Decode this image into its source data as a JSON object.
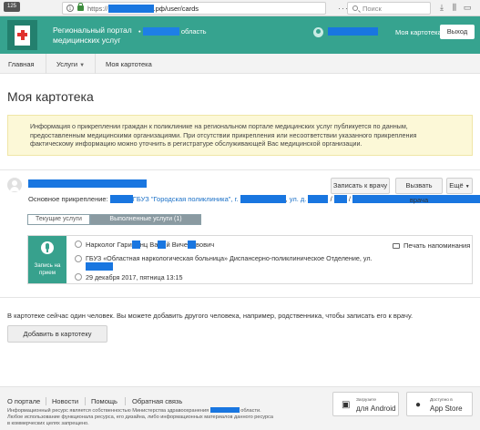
{
  "browser": {
    "tab_badge": "125",
    "url_prefix": "https://",
    "url_suffix": ".рф/user/cards",
    "search_placeholder": "Поиск"
  },
  "header": {
    "portal_title": "Региональный портал медицинских услуг",
    "region_suffix": "область",
    "my_card_link": "Моя картотека",
    "logout_label": "Выход"
  },
  "breadcrumb": {
    "items": [
      "Главная",
      "Услуги",
      "Моя картотека"
    ]
  },
  "page": {
    "title": "Моя картотека",
    "notice": "Информация о прикреплении граждан к поликлинике на региональном портале медицинских услуг публикуется по данным, предоставленным медицинскими организациями. При отсутствии прикрепления или несоответствии указанного прикрепления фактическому информацию можно уточнить в регистратуре обслуживающей Вас медицинской организации."
  },
  "person": {
    "attach_label": "Основное прикрепление:",
    "attach_org": "ГБУЗ \"Городская поликлиника\", г.",
    "attach_street": "ул. д.",
    "buttons": {
      "book_doctor": "Записать к врачу",
      "call_doctor": "Вызвать врача",
      "more": "Ещё"
    },
    "tabs": {
      "current": "Текущие услуги",
      "done": "Выполненные услуги (1)"
    }
  },
  "appointment": {
    "type_label": "Запись на прием",
    "doctor_spec": "Нарколог",
    "doctor_name_1": "Гари",
    "doctor_name_2": "нц Ва",
    "doctor_name_3": "й Виче",
    "doctor_name_4": "вович",
    "place": "ГБУЗ «Областная наркологическая больница» Диспансерно-поликлиническое Отделение, ул.",
    "date": "29 декабря 2017, пятница 13:15",
    "print_label": "Печать напоминания"
  },
  "footer_section": {
    "info": "В картотеке сейчас один человек. Вы можете добавить другого человека, например, родственника, чтобы записать его к врачу.",
    "add_button": "Добавить в картотеку"
  },
  "footer": {
    "links": [
      "О портале",
      "Новости",
      "Помощь",
      "Обратная связь"
    ],
    "text_1": "Информационный ресурс является собственностью Министерства здравоохранения",
    "text_2": "области.",
    "text_3": "Любое использование функционала ресурса, его дизайна, либо информационных материалов данного ресурса",
    "text_4": "в коммерческих целях запрещено.",
    "android": {
      "small": "Загрузите",
      "big": "для Android"
    },
    "apple": {
      "small": "Доступно в",
      "big": "App Store"
    }
  },
  "colors": {
    "header_green": "#36a38f",
    "logo_dark": "#23806e",
    "redaction_blue": "#1976e0",
    "notice_bg": "#fcf8d7",
    "link_blue": "#1a70c7",
    "tab_active": "#8a9aa1"
  },
  "icons": [
    "info-icon",
    "lock-icon",
    "more-icon",
    "shield-icon",
    "star-icon",
    "search-icon",
    "download-icon",
    "library-icon",
    "reader-icon",
    "user-icon",
    "avatar-icon",
    "mic-icon",
    "doctor-icon",
    "location-icon",
    "clock-icon",
    "printer-icon",
    "android-icon",
    "apple-icon"
  ]
}
